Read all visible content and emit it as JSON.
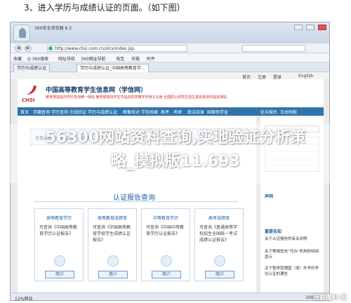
{
  "caption": "3、进入学历与成绩认证的页面。（如下图）",
  "browser": {
    "title": "360安全浏览器 6.3",
    "url": "http://www.chsi.com.cn/xlcx/index.jsp",
    "back_glyph": "◀",
    "forward_glyph": "▶",
    "favorites": [
      "收藏",
      "Q 360搜索",
      "网址导航",
      "360网址导航",
      "淘宝",
      "天猫",
      "附件"
    ],
    "tabs": [
      "学历与成绩认证",
      "学历与成绩认证_中国高等教育学..."
    ],
    "status_left": "11%网站",
    "status_right": "100%"
  },
  "page": {
    "top_links": [
      "首页",
      "注册",
      "登录",
      "English"
    ],
    "logo_text": "CHSI",
    "site_title": "中国高等教育学生信息网（学信网）",
    "site_subtitle": "教育部指定的学历查询唯一网站 教育部高校学生司指定的学籍学历电子注册 全国硕士研究生招生报名和调剂指定网站",
    "nav": [
      "首页",
      "学籍查询",
      "学历查询",
      "在线验证",
      "学历与成绩认证",
      "图像校对",
      "学信档案",
      "高考",
      "考研",
      "政法招录",
      "国家助学金",
      "征兵报名",
      "日本网报"
    ],
    "banner": "查看最新学历与成绩认证信息",
    "section_title": "认证报告查询",
    "cards": [
      {
        "title": "高等教育学历",
        "desc": "可查询《中国高等教育学历认证报告》",
        "button": "简介"
      },
      {
        "title": "高等教育成绩单",
        "desc": "可查询《中国高等教育学校学生成绩认证报告》",
        "button": "简介"
      },
      {
        "title": "中等教育学历",
        "desc": "可查询《中国中等教育学历认证报告》",
        "button": "简介"
      },
      {
        "title": "高考成绩单",
        "desc": "可查询《普通高等学校招生全国统一考试成绩认证报告》",
        "button": "简介"
      }
    ],
    "sidebar": {
      "heading1": "声明",
      "heading2": "重要告知",
      "items": [
        "关于认证报告的有关说明",
        "关于警惕冒充“代办”机构的特别提示",
        "关于暂停受理国（境）外学历学位认证的通告"
      ]
    }
  },
  "overlay": {
    "line1": "56300网站资料查询,实地验证分析策",
    "line2": "略_模拟版11.693"
  },
  "watermark": "我要爆料·盟"
}
